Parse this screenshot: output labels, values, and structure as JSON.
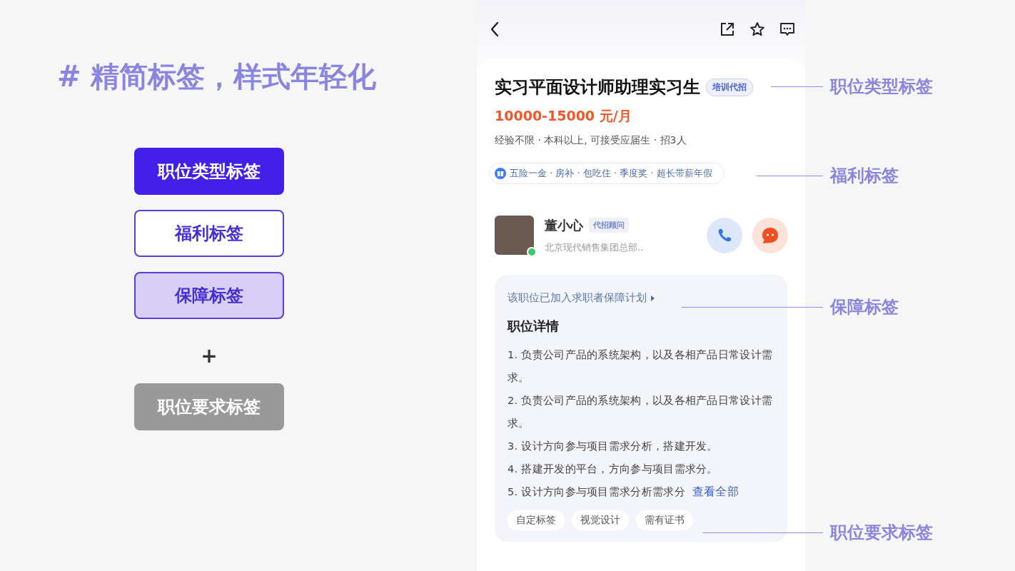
{
  "slide_title": "# 精简标签，样式年轻化",
  "legend": [
    {
      "label": "职位类型标签",
      "kind": "solid"
    },
    {
      "label": "福利标签",
      "kind": "outline"
    },
    {
      "label": "保障标签",
      "kind": "soft"
    },
    {
      "label": "+",
      "kind": "plus"
    },
    {
      "label": "职位要求标签",
      "kind": "gray"
    }
  ],
  "job": {
    "title": "实习平面设计师助理实习生",
    "type_tag": "培训代招",
    "salary": "10000-15000 元/月",
    "requirements": "经验不限 · 本科以上, 可接受应届生 · 招3人",
    "benefits": "五险一金 · 房补 · 包吃住 · 季度奖 · 超长带薪年假"
  },
  "recruiter": {
    "name": "董小心",
    "role_tag": "代招顾问",
    "company": "北京现代销售集团总部..",
    "online": true
  },
  "guarantee_link": "该职位已加入求职者保障计划",
  "details": {
    "heading": "职位详情",
    "lines": [
      "1. 负责公司产品的系统架构，以及各相产品日常设计需求。",
      "2. 负责公司产品的系统架构，以及各相产品日常设计需求。",
      "3. 设计方向参与项目需求分析，搭建开发。",
      "4. 搭建开发的平台，方向参与项目需求分。",
      "5. 设计方向参与项目需求分析需求分"
    ],
    "more_link": "查看全部"
  },
  "requirement_tags": [
    "自定标签",
    "视觉设计",
    "需有证书"
  ],
  "callouts": [
    "职位类型标签",
    "福利标签",
    "保障标签",
    "职位要求标签"
  ]
}
